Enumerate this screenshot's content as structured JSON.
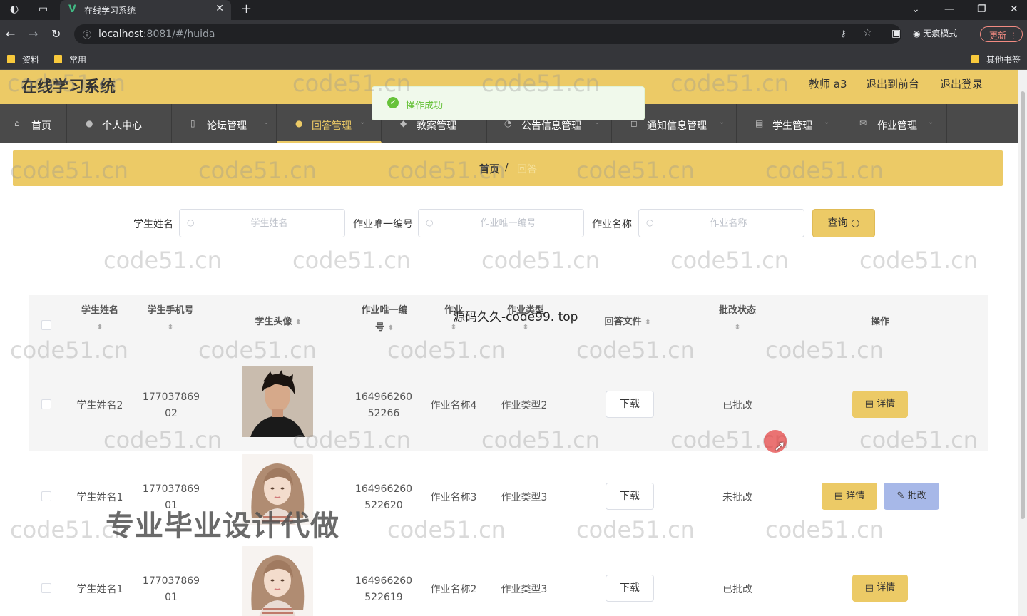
{
  "browser": {
    "tab_title": "在线学习系统",
    "url_host": "localhost",
    "url_rest": ":8081/#/huida",
    "incognito_label": "无痕模式",
    "update_label": "更新",
    "bookmarks": [
      "资料",
      "常用"
    ],
    "other_bookmarks": "其他书签"
  },
  "header": {
    "title": "在线学习系统",
    "user": "教师 a3",
    "to_front": "退出到前台",
    "logout": "退出登录"
  },
  "menu": [
    {
      "label": "首页",
      "icon": "home-icon"
    },
    {
      "label": "个人中心",
      "icon": "user-icon"
    },
    {
      "label": "论坛管理",
      "icon": "forum-icon"
    },
    {
      "label": "回答管理",
      "icon": "user-icon",
      "active": true
    },
    {
      "label": "教案管理",
      "icon": "book-icon"
    },
    {
      "label": "公告信息管理",
      "icon": "bell-icon"
    },
    {
      "label": "通知信息管理",
      "icon": "notice-icon"
    },
    {
      "label": "学生管理",
      "icon": "student-icon"
    },
    {
      "label": "作业管理",
      "icon": "mail-icon"
    }
  ],
  "toast": {
    "message": "操作成功"
  },
  "breadcrumb": {
    "home": "首页",
    "separator": "/",
    "current": "回答"
  },
  "search": {
    "student_name_label": "学生姓名",
    "student_name_placeholder": "学生姓名",
    "homework_id_label": "作业唯一编号",
    "homework_id_placeholder": "作业唯一编号",
    "homework_name_label": "作业名称",
    "homework_name_placeholder": "作业名称",
    "query_label": "查询"
  },
  "table": {
    "headers": {
      "student_name": [
        "学生姓名"
      ],
      "student_phone": [
        "学生手机号"
      ],
      "avatar": "学生头像",
      "homework_id": [
        "作业唯一编",
        "号"
      ],
      "homework_name": "作业",
      "homework_type": "作业类型",
      "answer_file": "回答文件",
      "review_status": "批改状态",
      "actions": "操作"
    },
    "download_label": "下载",
    "detail_label": "详情",
    "review_label": "批改",
    "rows": [
      {
        "name": "学生姓名2",
        "phone": [
          "177037869",
          "02"
        ],
        "avatar": "male",
        "hw_id": [
          "164966260",
          "52266"
        ],
        "hw_name": "作业名称4",
        "hw_type": "作业类型2",
        "status": "已批改",
        "can_review": false
      },
      {
        "name": "学生姓名1",
        "phone": [
          "177037869",
          "01"
        ],
        "avatar": "female",
        "hw_id": [
          "164966260",
          "522620"
        ],
        "hw_name": "作业名称3",
        "hw_type": "作业类型3",
        "status": "未批改",
        "can_review": true
      },
      {
        "name": "学生姓名1",
        "phone": [
          "177037869",
          "01"
        ],
        "avatar": "female",
        "hw_id": [
          "164966260",
          "522619"
        ],
        "hw_name": "作业名称2",
        "hw_type": "作业类型3",
        "status": "已批改",
        "can_review": false
      }
    ]
  },
  "overlays": {
    "source_text": "源码久久-code99. top",
    "promo_text": "专业毕业设计代做",
    "watermark": "code51.cn"
  }
}
